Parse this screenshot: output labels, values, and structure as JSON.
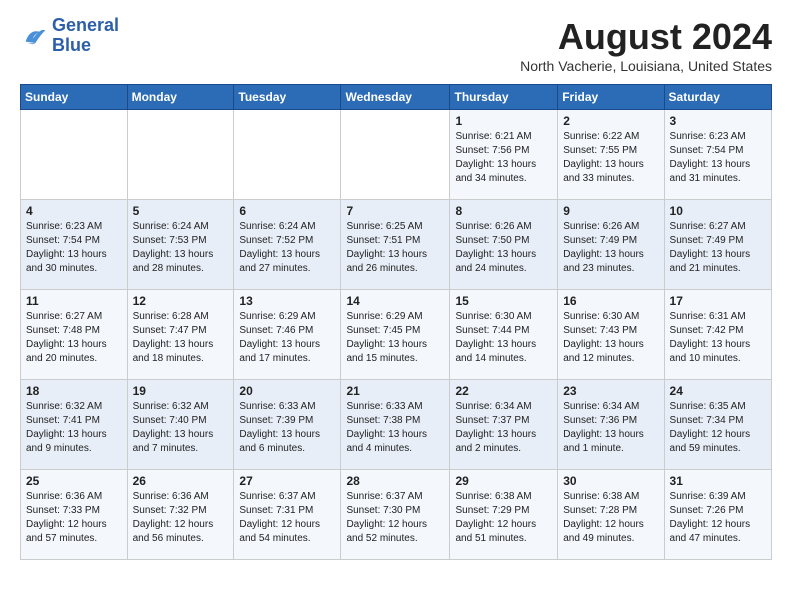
{
  "logo": {
    "line1": "General",
    "line2": "Blue"
  },
  "title": "August 2024",
  "location": "North Vacherie, Louisiana, United States",
  "days_of_week": [
    "Sunday",
    "Monday",
    "Tuesday",
    "Wednesday",
    "Thursday",
    "Friday",
    "Saturday"
  ],
  "weeks": [
    [
      {
        "day": "",
        "info": ""
      },
      {
        "day": "",
        "info": ""
      },
      {
        "day": "",
        "info": ""
      },
      {
        "day": "",
        "info": ""
      },
      {
        "day": "1",
        "info": "Sunrise: 6:21 AM\nSunset: 7:56 PM\nDaylight: 13 hours\nand 34 minutes."
      },
      {
        "day": "2",
        "info": "Sunrise: 6:22 AM\nSunset: 7:55 PM\nDaylight: 13 hours\nand 33 minutes."
      },
      {
        "day": "3",
        "info": "Sunrise: 6:23 AM\nSunset: 7:54 PM\nDaylight: 13 hours\nand 31 minutes."
      }
    ],
    [
      {
        "day": "4",
        "info": "Sunrise: 6:23 AM\nSunset: 7:54 PM\nDaylight: 13 hours\nand 30 minutes."
      },
      {
        "day": "5",
        "info": "Sunrise: 6:24 AM\nSunset: 7:53 PM\nDaylight: 13 hours\nand 28 minutes."
      },
      {
        "day": "6",
        "info": "Sunrise: 6:24 AM\nSunset: 7:52 PM\nDaylight: 13 hours\nand 27 minutes."
      },
      {
        "day": "7",
        "info": "Sunrise: 6:25 AM\nSunset: 7:51 PM\nDaylight: 13 hours\nand 26 minutes."
      },
      {
        "day": "8",
        "info": "Sunrise: 6:26 AM\nSunset: 7:50 PM\nDaylight: 13 hours\nand 24 minutes."
      },
      {
        "day": "9",
        "info": "Sunrise: 6:26 AM\nSunset: 7:49 PM\nDaylight: 13 hours\nand 23 minutes."
      },
      {
        "day": "10",
        "info": "Sunrise: 6:27 AM\nSunset: 7:49 PM\nDaylight: 13 hours\nand 21 minutes."
      }
    ],
    [
      {
        "day": "11",
        "info": "Sunrise: 6:27 AM\nSunset: 7:48 PM\nDaylight: 13 hours\nand 20 minutes."
      },
      {
        "day": "12",
        "info": "Sunrise: 6:28 AM\nSunset: 7:47 PM\nDaylight: 13 hours\nand 18 minutes."
      },
      {
        "day": "13",
        "info": "Sunrise: 6:29 AM\nSunset: 7:46 PM\nDaylight: 13 hours\nand 17 minutes."
      },
      {
        "day": "14",
        "info": "Sunrise: 6:29 AM\nSunset: 7:45 PM\nDaylight: 13 hours\nand 15 minutes."
      },
      {
        "day": "15",
        "info": "Sunrise: 6:30 AM\nSunset: 7:44 PM\nDaylight: 13 hours\nand 14 minutes."
      },
      {
        "day": "16",
        "info": "Sunrise: 6:30 AM\nSunset: 7:43 PM\nDaylight: 13 hours\nand 12 minutes."
      },
      {
        "day": "17",
        "info": "Sunrise: 6:31 AM\nSunset: 7:42 PM\nDaylight: 13 hours\nand 10 minutes."
      }
    ],
    [
      {
        "day": "18",
        "info": "Sunrise: 6:32 AM\nSunset: 7:41 PM\nDaylight: 13 hours\nand 9 minutes."
      },
      {
        "day": "19",
        "info": "Sunrise: 6:32 AM\nSunset: 7:40 PM\nDaylight: 13 hours\nand 7 minutes."
      },
      {
        "day": "20",
        "info": "Sunrise: 6:33 AM\nSunset: 7:39 PM\nDaylight: 13 hours\nand 6 minutes."
      },
      {
        "day": "21",
        "info": "Sunrise: 6:33 AM\nSunset: 7:38 PM\nDaylight: 13 hours\nand 4 minutes."
      },
      {
        "day": "22",
        "info": "Sunrise: 6:34 AM\nSunset: 7:37 PM\nDaylight: 13 hours\nand 2 minutes."
      },
      {
        "day": "23",
        "info": "Sunrise: 6:34 AM\nSunset: 7:36 PM\nDaylight: 13 hours\nand 1 minute."
      },
      {
        "day": "24",
        "info": "Sunrise: 6:35 AM\nSunset: 7:34 PM\nDaylight: 12 hours\nand 59 minutes."
      }
    ],
    [
      {
        "day": "25",
        "info": "Sunrise: 6:36 AM\nSunset: 7:33 PM\nDaylight: 12 hours\nand 57 minutes."
      },
      {
        "day": "26",
        "info": "Sunrise: 6:36 AM\nSunset: 7:32 PM\nDaylight: 12 hours\nand 56 minutes."
      },
      {
        "day": "27",
        "info": "Sunrise: 6:37 AM\nSunset: 7:31 PM\nDaylight: 12 hours\nand 54 minutes."
      },
      {
        "day": "28",
        "info": "Sunrise: 6:37 AM\nSunset: 7:30 PM\nDaylight: 12 hours\nand 52 minutes."
      },
      {
        "day": "29",
        "info": "Sunrise: 6:38 AM\nSunset: 7:29 PM\nDaylight: 12 hours\nand 51 minutes."
      },
      {
        "day": "30",
        "info": "Sunrise: 6:38 AM\nSunset: 7:28 PM\nDaylight: 12 hours\nand 49 minutes."
      },
      {
        "day": "31",
        "info": "Sunrise: 6:39 AM\nSunset: 7:26 PM\nDaylight: 12 hours\nand 47 minutes."
      }
    ]
  ]
}
